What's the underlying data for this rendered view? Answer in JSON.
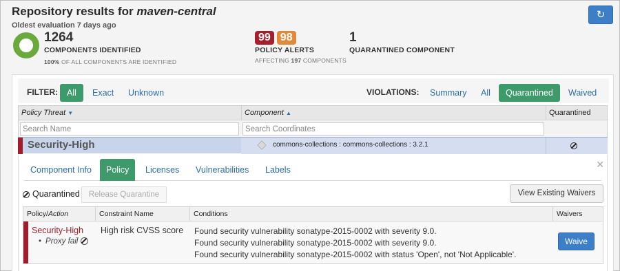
{
  "header": {
    "title_prefix": "Repository results for ",
    "repository": "maven-central",
    "subtitle": "Oldest evaluation 7 days ago"
  },
  "refresh_icon": "refresh-icon",
  "stats": {
    "components": {
      "count": "1264",
      "label": "COMPONENTS IDENTIFIED",
      "percent": "100%",
      "sub_text": "OF ALL COMPONENTS ARE IDENTIFIED",
      "donut_color": "#6aaa3c"
    },
    "alerts": {
      "critical": "99",
      "severe": "98",
      "label": "POLICY ALERTS",
      "affecting_prefix": "AFFECTING",
      "affecting_count": "197",
      "affecting_suffix": "COMPONENTS"
    },
    "quarantined": {
      "count": "1",
      "label": "QUARANTINED COMPONENT"
    }
  },
  "filter": {
    "label": "FILTER:",
    "options": [
      "All",
      "Exact",
      "Unknown"
    ],
    "active": "All"
  },
  "violations": {
    "label": "VIOLATIONS:",
    "options": [
      "Summary",
      "All",
      "Quarantined",
      "Waived"
    ],
    "active": "Quarantined"
  },
  "grid": {
    "columns": {
      "threat": "Policy Threat",
      "component": "Component",
      "quarantined": "Quarantined"
    },
    "search": {
      "name_placeholder": "Search Name",
      "coord_placeholder": "Search Coordinates"
    },
    "selected_row": {
      "threat": "Security-High",
      "coordinates": "commons-collections : commons-collections : 3.2.1"
    }
  },
  "detail": {
    "tabs": [
      "Component Info",
      "Policy",
      "Licenses",
      "Vulnerabilities",
      "Labels"
    ],
    "active_tab": "Policy",
    "quarantined_label": "Quarantined",
    "release_button": "Release Quarantine",
    "view_waivers_button": "View Existing Waivers",
    "table": {
      "headers": {
        "policy": "Policy/",
        "action": "Action",
        "constraint": "Constraint Name",
        "conditions": "Conditions",
        "waivers": "Waivers"
      },
      "row": {
        "policy": "Security-High",
        "action": "Proxy fail",
        "constraint": "High risk CVSS score",
        "conditions": [
          "Found security vulnerability sonatype-2015-0002 with severity 9.0.",
          "Found security vulnerability sonatype-2015-0002 with severity 9.0.",
          "Found security vulnerability sonatype-2015-0002 with status 'Open', not 'Not Applicable'."
        ],
        "waive_button": "Waive"
      }
    }
  },
  "colors": {
    "primary_blue": "#3d7ec8",
    "active_green": "#3f9a6b",
    "critical_red": "#a51f2c",
    "severe_orange": "#e08a3a"
  }
}
